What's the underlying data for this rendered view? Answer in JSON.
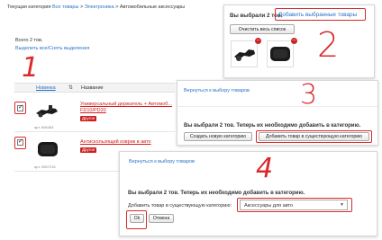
{
  "breadcrumb": {
    "label": "Текущая категория",
    "all": "Все товары",
    "sep": ">",
    "electronics": "Электроника",
    "current": "Автомобильные аксессуары"
  },
  "list": {
    "total": "Всего 2 тов.",
    "select_all": "Выделить все/Снять выделения",
    "columns": {
      "novelty": "Новинка",
      "name": "Название"
    },
    "items": [
      {
        "name": "Универсальный держатель + Автомоб... FD10/PD20",
        "article": "арт. 806483",
        "tag": "Другое"
      },
      {
        "name": "Антискользящий коврик в авто",
        "article": "арт. 5557216",
        "tag": "Другое"
      }
    ]
  },
  "step2": {
    "selected": "Вы выбрали 2 тов.",
    "add_link": "Добавить выбранные товары",
    "clear": "Очистить весь список"
  },
  "step3": {
    "back": "Вернуться к выбору товаров",
    "message": "Вы выбрали 2 тов. Теперь их необходимо добавить в категорию.",
    "create": "Создать новую категорию",
    "add_existing": "Добавить товар в существующую категорию"
  },
  "step4": {
    "back": "Вернуться к выбору товаров",
    "message": "Вы выбрали 2 тов. Теперь их необходимо добавить в категорию.",
    "label": "Добавить товар в существующую категорию:",
    "selected": "Аксессуары для авто",
    "ok": "Ok",
    "cancel": "Отмена"
  },
  "steps": [
    "1",
    "2",
    "3",
    "4"
  ],
  "colors": {
    "link": "#2a73c7",
    "annotation": "#d92a2a",
    "tag": "#cc1f1f"
  }
}
